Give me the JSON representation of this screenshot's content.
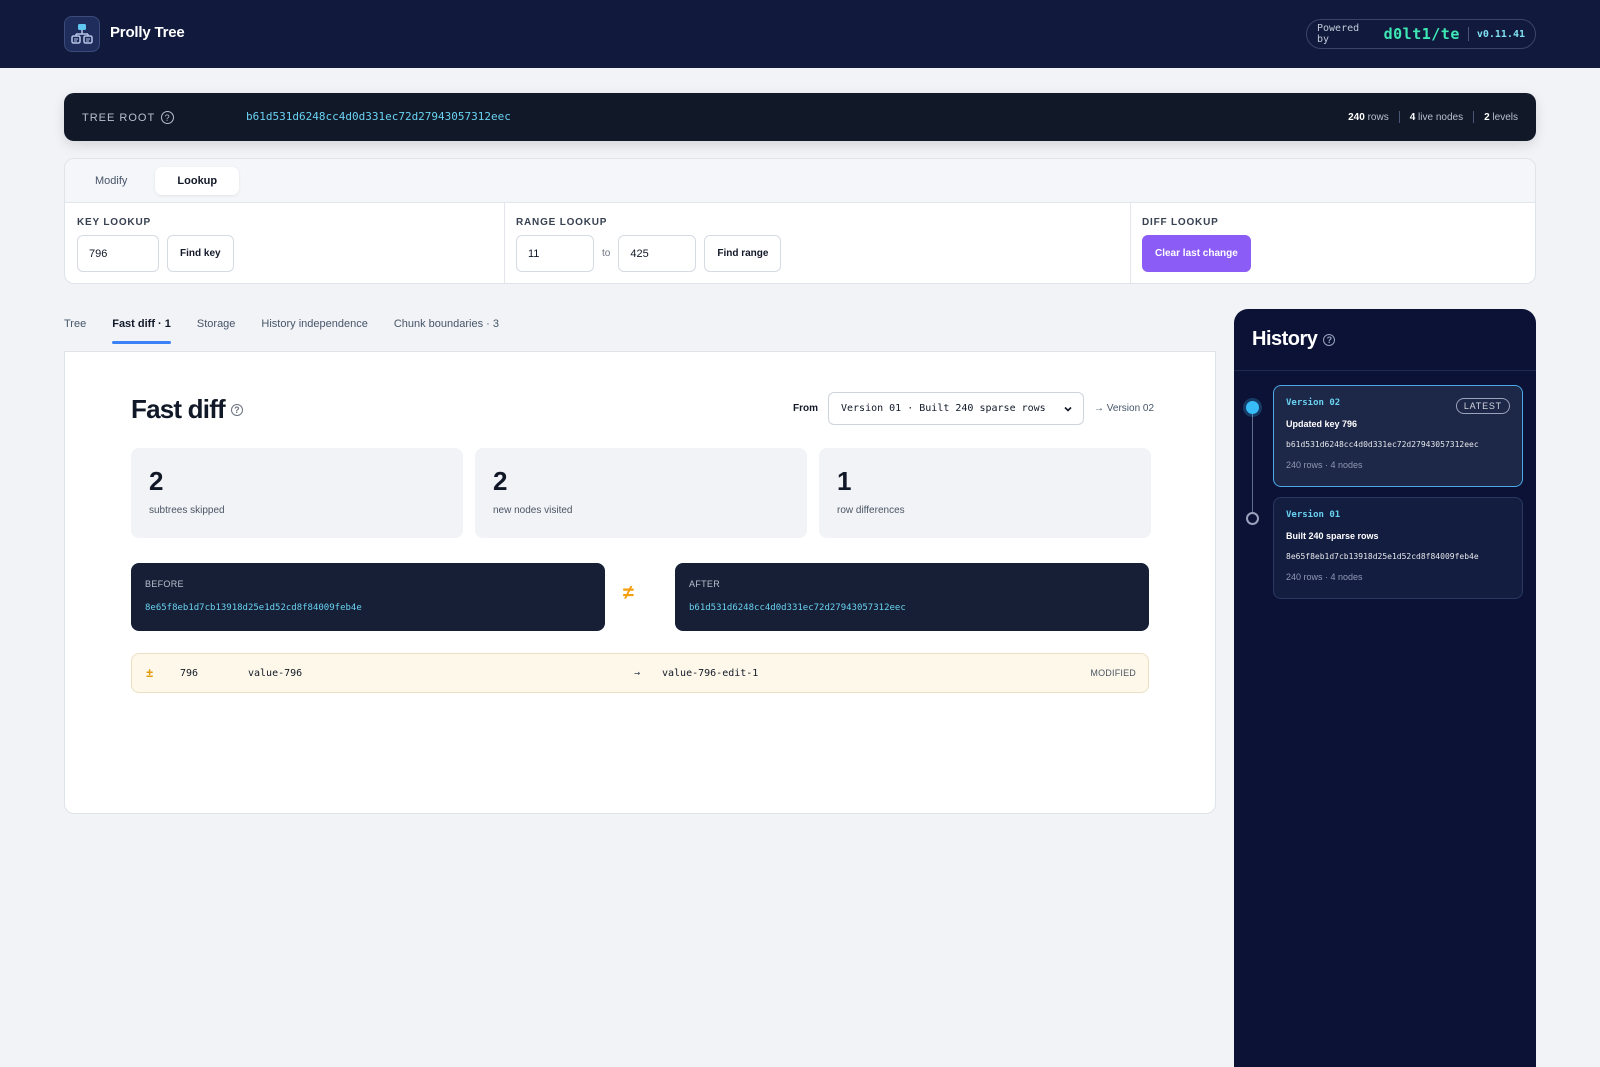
{
  "app": {
    "title": "Prolly Tree",
    "powered_by": "Powered by",
    "brand": "d0lt1/te",
    "version": "v0.11.41"
  },
  "root": {
    "label": "TREE ROOT",
    "hash": "b61d531d6248cc4d0d331ec72d27943057312eec",
    "rows_value": "240",
    "rows_label": "rows",
    "nodes_value": "4",
    "nodes_label": "live nodes",
    "levels_value": "2",
    "levels_label": "levels"
  },
  "controls": {
    "tabs": [
      "Modify",
      "Lookup"
    ],
    "active_tab": "Lookup",
    "key_lookup": {
      "title": "KEY LOOKUP",
      "value": "796",
      "button": "Find key"
    },
    "range_lookup": {
      "title": "RANGE LOOKUP",
      "from": "11",
      "to_label": "to",
      "to": "425",
      "button": "Find range"
    },
    "diff_lookup": {
      "title": "DIFF LOOKUP",
      "button": "Clear last change"
    }
  },
  "main_tabs": [
    "Tree",
    "Fast diff · 1",
    "Storage",
    "History independence",
    "Chunk boundaries · 3"
  ],
  "active_main_tab": "Fast diff · 1",
  "fast_diff": {
    "title": "Fast diff",
    "from_label": "From",
    "from_selected": "Version 01 · Built 240 sparse rows",
    "to_version": "→ Version 02",
    "stats": [
      {
        "value": "2",
        "label": "subtrees skipped"
      },
      {
        "value": "2",
        "label": "new nodes visited"
      },
      {
        "value": "1",
        "label": "row differences"
      }
    ],
    "before": {
      "label": "BEFORE",
      "hash": "8e65f8eb1d7cb13918d25e1d52cd8f84009feb4e"
    },
    "after": {
      "label": "AFTER",
      "hash": "b61d531d6248cc4d0d331ec72d27943057312eec"
    },
    "neq_symbol": "≠",
    "rows": [
      {
        "symbol": "±",
        "key": "796",
        "old": "value-796",
        "arrow": "→",
        "new": "value-796-edit-1",
        "kind": "MODIFIED"
      }
    ]
  },
  "history": {
    "title": "History",
    "versions": [
      {
        "name": "Version 02",
        "badge": "LATEST",
        "message": "Updated key 796",
        "hash": "b61d531d6248cc4d0d331ec72d27943057312eec",
        "meta": "240 rows · 4 nodes"
      },
      {
        "name": "Version 01",
        "message": "Built 240 sparse rows",
        "hash": "8e65f8eb1d7cb13918d25e1d52cd8f84009feb4e",
        "meta": "240 rows · 4 nodes"
      }
    ]
  },
  "colors": {
    "nav": "#111a3d",
    "accent": "#3b82f6",
    "primary_button": "#8b5cf6",
    "hash": "#69d2f2",
    "brand": "#3ee8b5",
    "modified": "#f59e0b"
  }
}
